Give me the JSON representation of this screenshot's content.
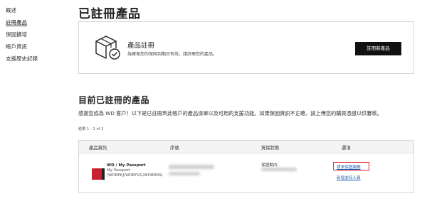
{
  "sidebar": {
    "items": [
      {
        "label": "概述"
      },
      {
        "label": "註冊產品"
      },
      {
        "label": "保固擴增"
      },
      {
        "label": "帳戶資訊"
      },
      {
        "label": "支援歷史記錄"
      }
    ]
  },
  "page": {
    "title": "已註冊產品"
  },
  "registration": {
    "title": "產品註冊",
    "description": "為確保您的保固到期日有效，請註冊您的產品。",
    "button_label": "註冊新產品"
  },
  "registered": {
    "title": "目前已註冊的產品",
    "description": "感謝您成為 WD 客戶！以下是已註冊到此帳戶的產品清單以及可用的支援功能。如果保固資訊不正確，請上傳您的購買憑證以供審核。",
    "results": "結果 1 - 1 of 1",
    "columns": [
      "產品資訊",
      "序號",
      "質保狀態",
      "選項"
    ],
    "rows": [
      {
        "product_name": "WD / My Passport",
        "product_line": "My Passport",
        "product_model": "(WDBPKJ/WDBYVG/WDBR9S)",
        "warranty_status": "保固期內",
        "actions": [
          "請求保固服務",
          "新增支持人員"
        ]
      }
    ]
  },
  "colors": {
    "primary_button": "#111111",
    "link": "#1a5fb4",
    "highlight": "#e0242e",
    "product_red": "#c9202f"
  }
}
